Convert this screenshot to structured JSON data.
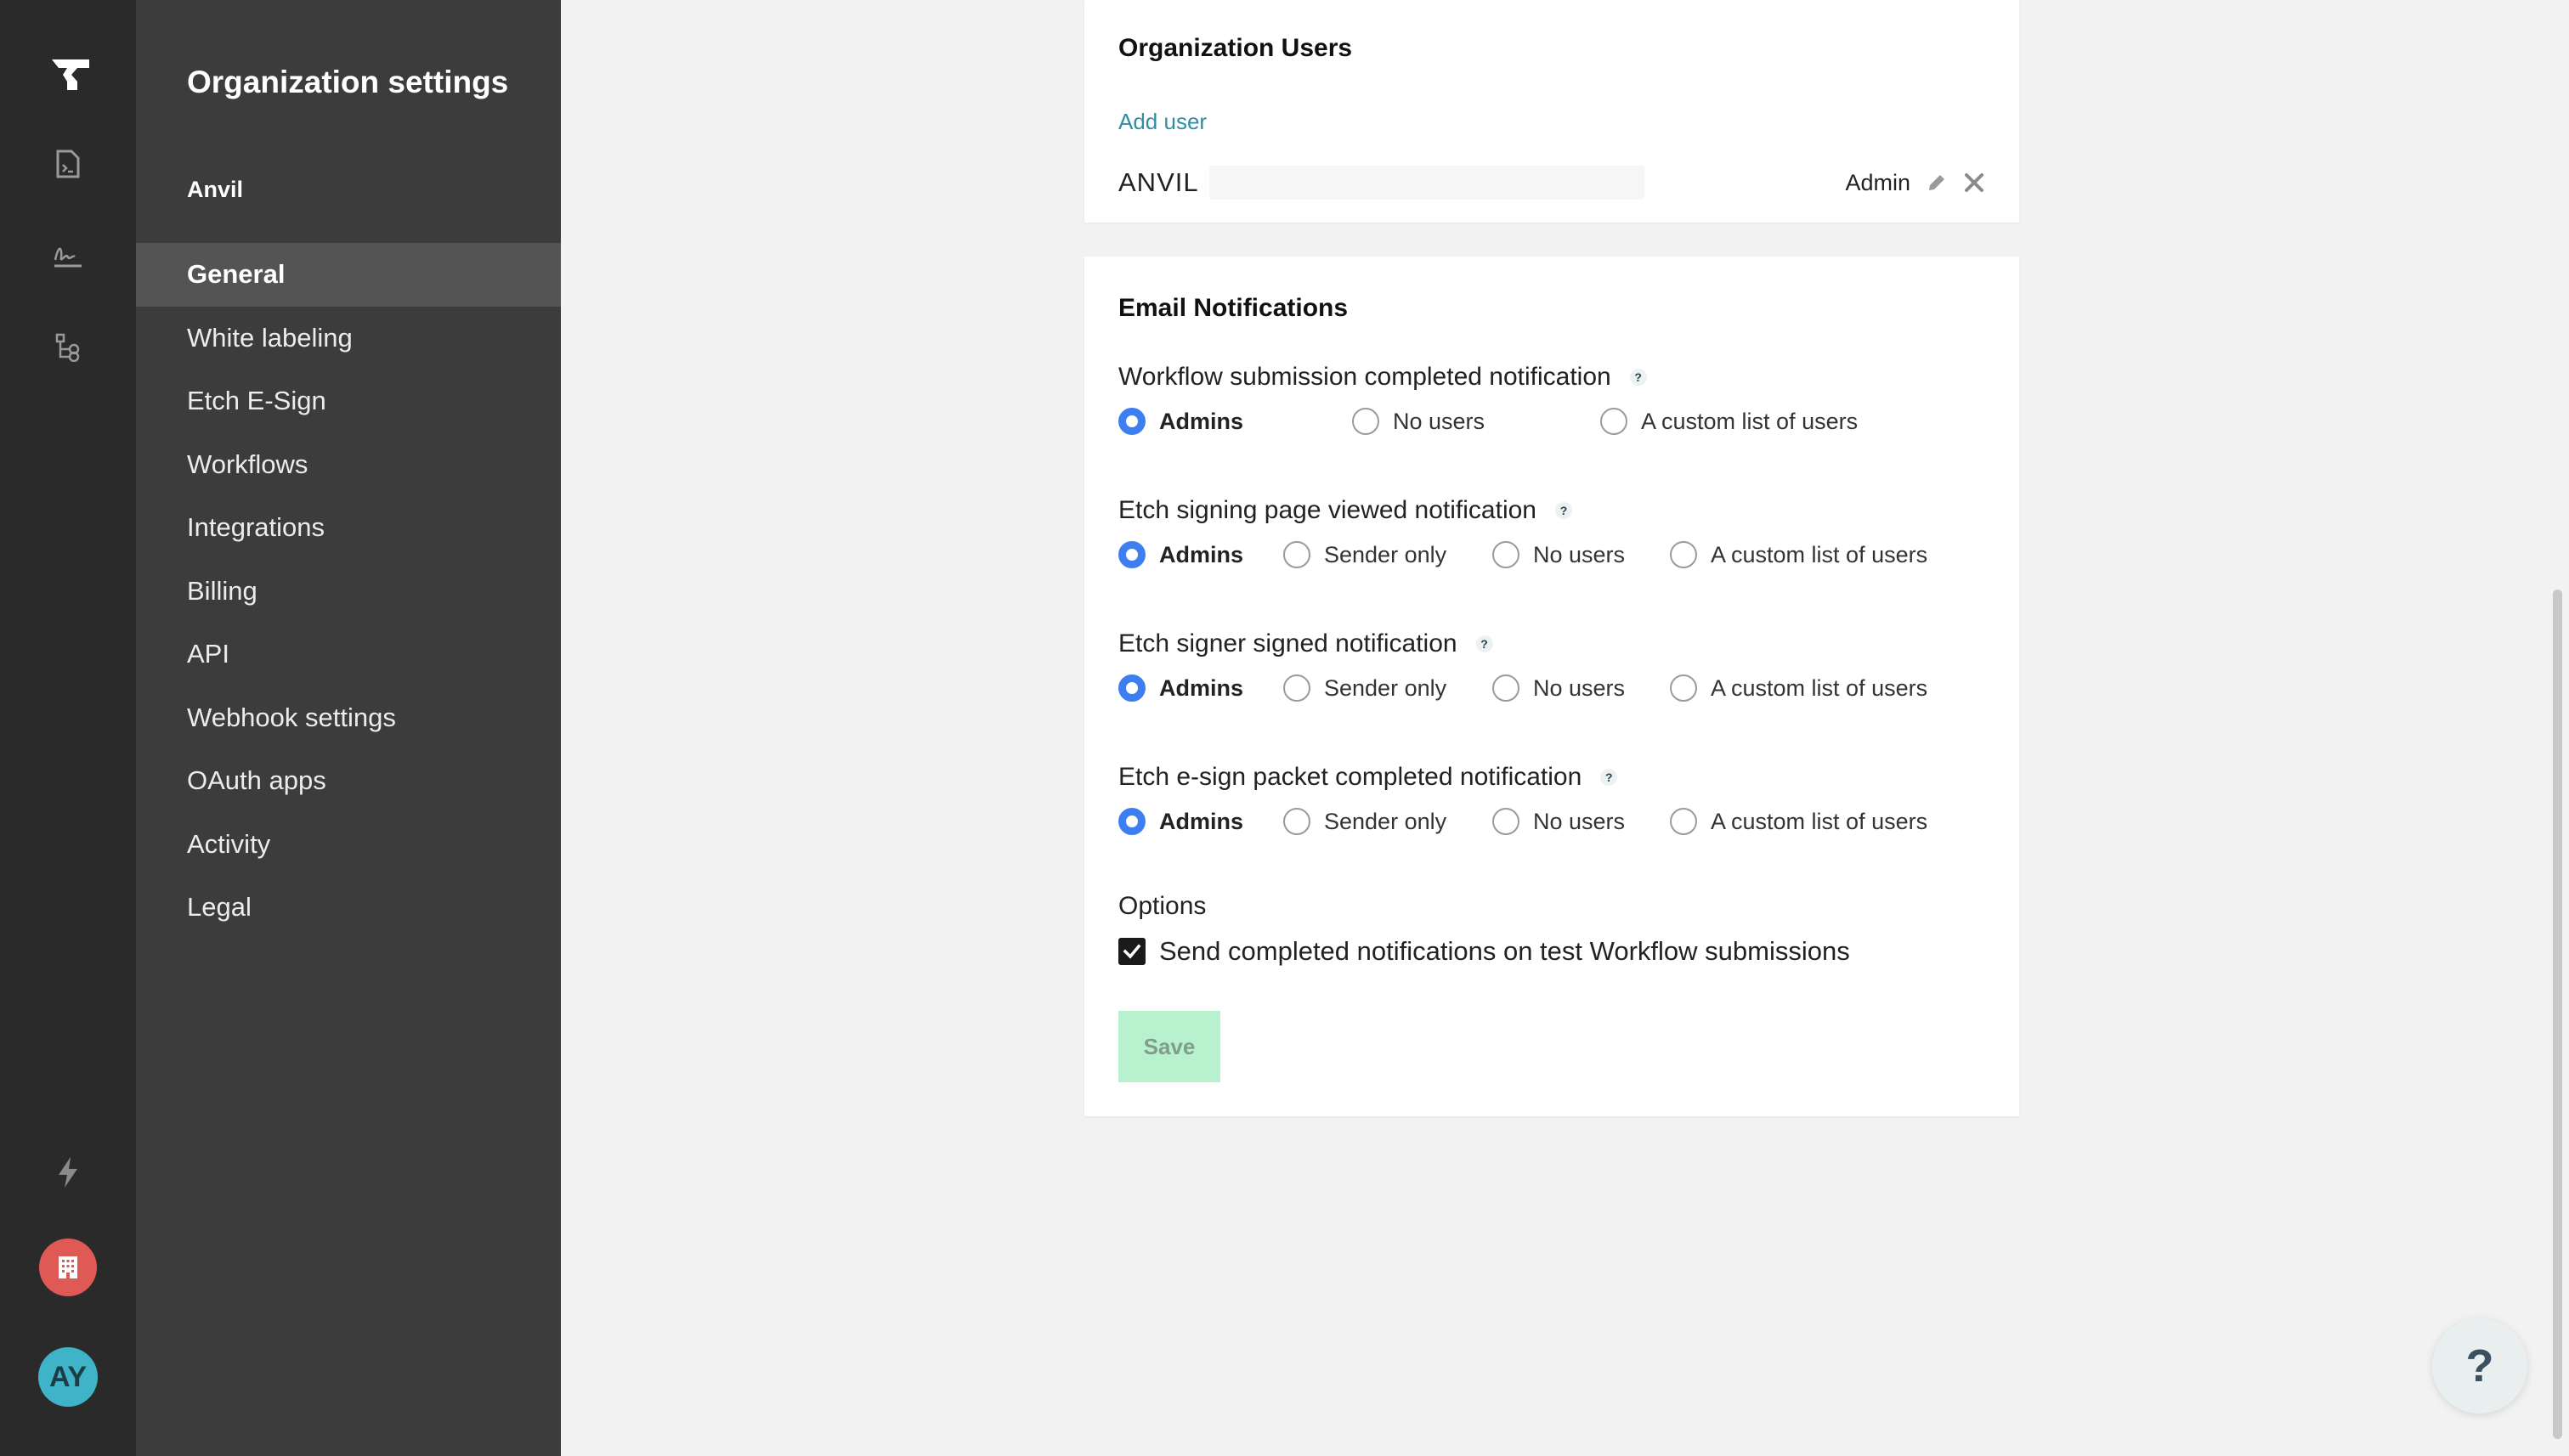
{
  "sidebar": {
    "title": "Organization settings",
    "org_name": "Anvil",
    "items": [
      {
        "label": "General",
        "active": true
      },
      {
        "label": "White labeling"
      },
      {
        "label": "Etch E-Sign"
      },
      {
        "label": "Workflows"
      },
      {
        "label": "Integrations"
      },
      {
        "label": "Billing"
      },
      {
        "label": "API"
      },
      {
        "label": "Webhook settings"
      },
      {
        "label": "OAuth apps"
      },
      {
        "label": "Activity"
      },
      {
        "label": "Legal"
      }
    ]
  },
  "rail": {
    "icons": [
      "anvil-logo-icon",
      "document-icon",
      "signature-icon",
      "workflow-icon",
      "bolt-icon",
      "building-icon"
    ],
    "avatar_initials": "AY"
  },
  "org_users": {
    "title": "Organization Users",
    "add_user_label": "Add user",
    "users": [
      {
        "org": "ANVIL",
        "role": "Admin"
      }
    ]
  },
  "email_notifications": {
    "title": "Email Notifications",
    "groups": [
      {
        "label": "Workflow submission completed notification",
        "options": [
          "Admins",
          "No users",
          "A custom list of users"
        ],
        "selected": "Admins"
      },
      {
        "label": "Etch signing page viewed notification",
        "options": [
          "Admins",
          "Sender only",
          "No users",
          "A custom list of users"
        ],
        "selected": "Admins"
      },
      {
        "label": "Etch signer signed notification",
        "options": [
          "Admins",
          "Sender only",
          "No users",
          "A custom list of users"
        ],
        "selected": "Admins"
      },
      {
        "label": "Etch e-sign packet completed notification",
        "options": [
          "Admins",
          "Sender only",
          "No users",
          "A custom list of users"
        ],
        "selected": "Admins"
      }
    ],
    "help_glyph": "?",
    "options_title": "Options",
    "test_submission_checkbox": {
      "label": "Send completed notifications on test Workflow submissions",
      "checked": true
    },
    "save_label": "Save"
  },
  "help_fab_label": "?",
  "colors": {
    "rail_bg": "#2a2a2a",
    "sidebar_bg": "#3c3c3c",
    "sidebar_active": "#545454",
    "radio_selected": "#3d7ff0",
    "link": "#2f8ea3",
    "save_bg": "#b7f1cd",
    "org_badge": "#e05a55",
    "avatar_bg": "#3fb4c8"
  }
}
